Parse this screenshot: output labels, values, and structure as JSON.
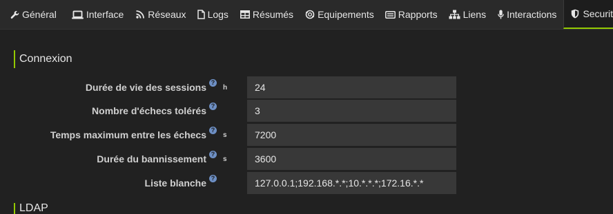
{
  "tabs": [
    {
      "label": "Général",
      "icon": "wrench-icon",
      "active": false
    },
    {
      "label": "Interface",
      "icon": "laptop-icon",
      "active": false
    },
    {
      "label": "Réseaux",
      "icon": "rss-icon",
      "active": false
    },
    {
      "label": "Logs",
      "icon": "file-icon",
      "active": false
    },
    {
      "label": "Résumés",
      "icon": "table-icon",
      "active": false
    },
    {
      "label": "Equipements",
      "icon": "devices-icon",
      "active": false
    },
    {
      "label": "Rapports",
      "icon": "card-icon",
      "active": false
    },
    {
      "label": "Liens",
      "icon": "sitemap-icon",
      "active": false
    },
    {
      "label": "Interactions",
      "icon": "microphone-icon",
      "active": false
    },
    {
      "label": "Securité",
      "icon": "shield-icon",
      "active": true
    }
  ],
  "section": {
    "title": "Connexion",
    "next_title": "LDAP"
  },
  "fields": {
    "session_lifetime": {
      "label": "Durée de vie des sessions",
      "unit": "h",
      "value": "24"
    },
    "failures_allowed": {
      "label": "Nombre d'échecs tolérés",
      "unit": "",
      "value": "3"
    },
    "max_time_between_failures": {
      "label": "Temps maximum entre les échecs",
      "unit": "s",
      "value": "7200"
    },
    "ban_duration": {
      "label": "Durée du bannissement",
      "unit": "s",
      "value": "3600"
    },
    "whitelist": {
      "label": "Liste blanche",
      "unit": "",
      "value": "127.0.0.1;192.168.*.*;10.*.*.*;172.16.*.*"
    }
  },
  "help_glyph": "?",
  "colors": {
    "accent": "#94ca02",
    "background": "#212121",
    "field_bg": "#383838",
    "help_icon": "#6d8fc4"
  }
}
